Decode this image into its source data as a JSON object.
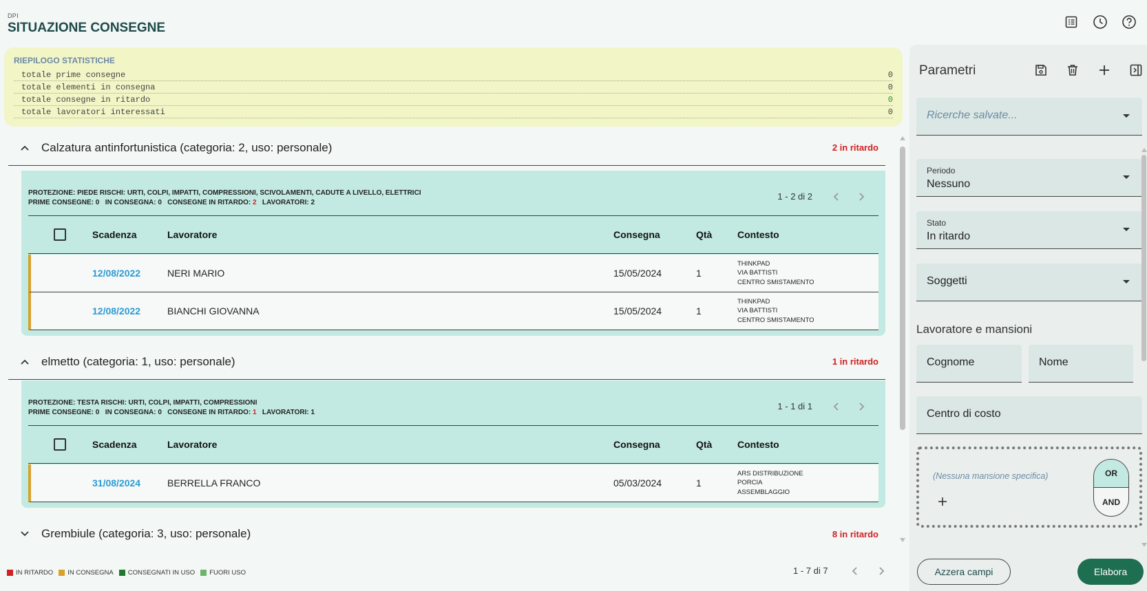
{
  "header": {
    "section": "DPI",
    "title": "SITUAZIONE CONSEGNE"
  },
  "top_icons": [
    "list-icon",
    "clock-icon",
    "help-icon"
  ],
  "stats": {
    "title": "RIEPILOGO STATISTICHE",
    "rows": [
      {
        "label": "totale prime consegne",
        "value": "0"
      },
      {
        "label": "totale elementi in consegna",
        "value": "0"
      },
      {
        "label": "totale consegne in ritardo",
        "value": "0"
      },
      {
        "label": "totale lavoratori interessati",
        "value": "0"
      }
    ]
  },
  "table_headers": {
    "scadenza": "Scadenza",
    "lavoratore": "Lavoratore",
    "consegna": "Consegna",
    "qta": "Qtà",
    "contesto": "Contesto"
  },
  "groups": [
    {
      "title": "Calzatura antinfortunistica (categoria: 2, uso: personale)",
      "late": "2 in ritardo",
      "expanded": true,
      "info_line1": "PROTEZIONE: PIEDE   RISCHI: URTI, COLPI, IMPATTI, COMPRESSIONI, SCIVOLAMENTI, CADUTE A LIVELLO, ELETTRICI",
      "info_prime": "PRIME CONSEGNE: 0",
      "info_incons": "IN CONSEGNA: 0",
      "info_ritardo_label": "CONSEGNE IN RITARDO:",
      "info_ritardo_value": "2",
      "info_lav": "LAVORATORI: 2",
      "pager": "1 - 2 di 2",
      "rows": [
        {
          "scadenza": "12/08/2022",
          "lavoratore": "NERI MARIO",
          "consegna": "15/05/2024",
          "qta": "1",
          "ctx1": "THINKPAD",
          "ctx2": "VIA BATTISTI",
          "ctx3": "CENTRO SMISTAMENTO"
        },
        {
          "scadenza": "12/08/2022",
          "lavoratore": "BIANCHI GIOVANNA",
          "consegna": "15/05/2024",
          "qta": "1",
          "ctx1": "THINKPAD",
          "ctx2": "VIA BATTISTI",
          "ctx3": "CENTRO SMISTAMENTO"
        }
      ]
    },
    {
      "title": "elmetto (categoria: 1, uso: personale)",
      "late": "1 in ritardo",
      "expanded": true,
      "info_line1": "PROTEZIONE: TESTA   RISCHI: URTI, COLPI, IMPATTI, COMPRESSIONI",
      "info_prime": "PRIME CONSEGNE: 0",
      "info_incons": "IN CONSEGNA: 0",
      "info_ritardo_label": "CONSEGNE IN RITARDO:",
      "info_ritardo_value": "1",
      "info_lav": "LAVORATORI: 1",
      "pager": "1 - 1 di 1",
      "rows": [
        {
          "scadenza": "31/08/2024",
          "lavoratore": "BERRELLA FRANCO",
          "consegna": "05/03/2024",
          "qta": "1",
          "ctx1": "ARS DISTRIBUZIONE",
          "ctx2": "PORCIA",
          "ctx3": "ASSEMBLAGGIO"
        }
      ]
    },
    {
      "title": "Grembiule (categoria: 3, uso: personale)",
      "late": "8 in ritardo",
      "expanded": false
    }
  ],
  "legend": [
    {
      "label": "IN RITARDO",
      "color": "#d02020"
    },
    {
      "label": "IN CONSEGNA",
      "color": "#d9a12a"
    },
    {
      "label": "CONSEGNATI IN USO",
      "color": "#1e7a2a"
    },
    {
      "label": "FUORI USO",
      "color": "#6bb56b"
    }
  ],
  "main_pager": "1 - 7 di 7",
  "side": {
    "title": "Parametri",
    "saved_search_placeholder": "Ricerche salvate...",
    "periodo_label": "Periodo",
    "periodo_value": "Nessuno",
    "stato_label": "Stato",
    "stato_value": "In ritardo",
    "soggetti": "Soggetti",
    "section": "Lavoratore e mansioni",
    "cognome": "Cognome",
    "nome": "Nome",
    "centro": "Centro di costo",
    "mansioni_placeholder": "(Nessuna mansione specifica)",
    "or": "OR",
    "and": "AND",
    "reset": "Azzera campi",
    "go": "Elabora"
  }
}
